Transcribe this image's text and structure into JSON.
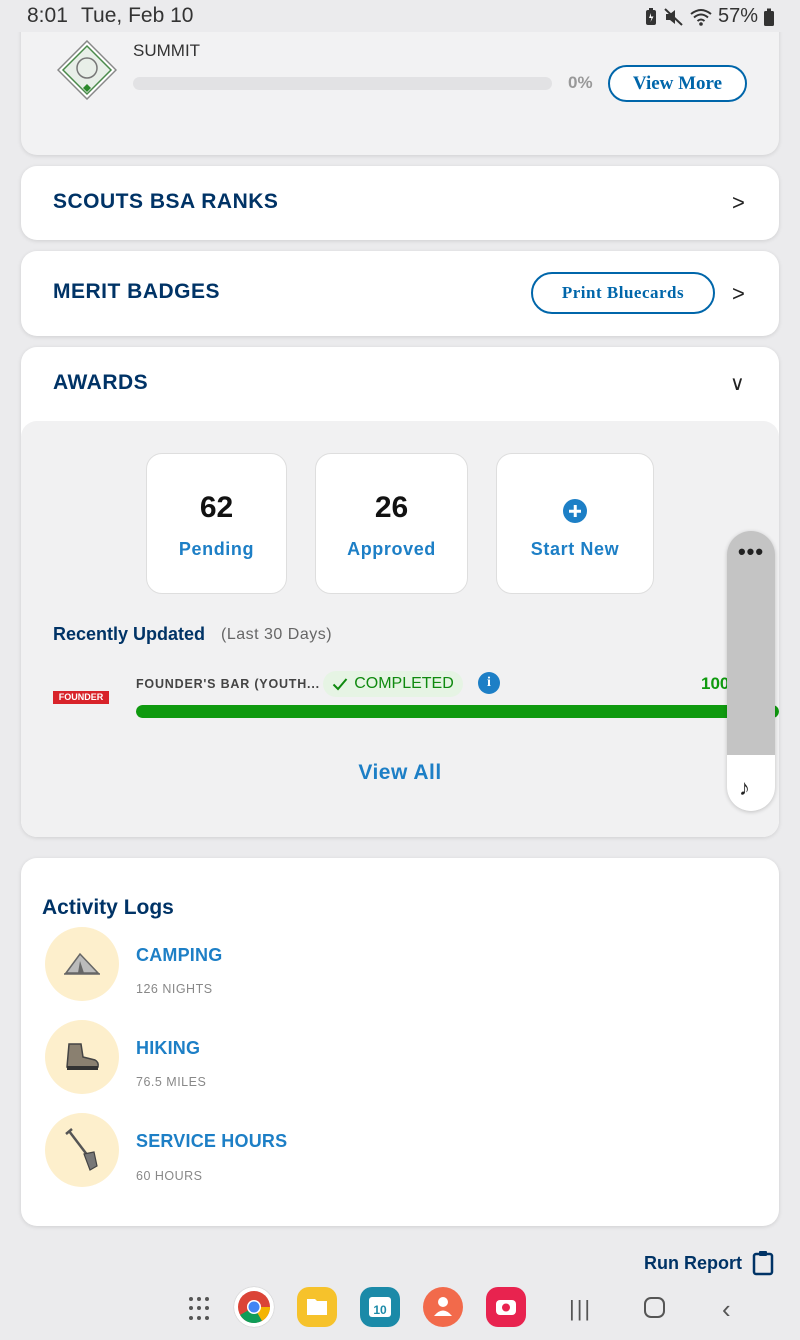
{
  "status_bar": {
    "time": "8:01",
    "date": "Tue, Feb 10",
    "battery": "57%"
  },
  "summit": {
    "name": "SUMMIT",
    "progress": 0,
    "percent_label": "0%",
    "view_more": "View More"
  },
  "ranks": {
    "title": "SCOUTS BSA RANKS",
    "chevron": ">"
  },
  "merit_badges": {
    "title": "MERIT BADGES",
    "print_label": "Print Bluecards",
    "chevron": ">"
  },
  "awards": {
    "title": "AWARDS",
    "chevron": "∨",
    "stats": [
      {
        "value": "62",
        "label": "Pending"
      },
      {
        "value": "26",
        "label": "Approved"
      }
    ],
    "start_new": "Start New",
    "recent_title": "Recently Updated",
    "recent_sub": "(Last 30 Days)",
    "recent_items": [
      {
        "logo_text": "FOUNDER",
        "name": "FOUNDER'S BAR (YOUTH...",
        "status": "COMPLETED",
        "percent_label": "100",
        "progress": 100
      }
    ],
    "view_all": "View All"
  },
  "activity_logs": {
    "title": "Activity Logs",
    "items": [
      {
        "name": "CAMPING",
        "value": "126 NIGHTS",
        "icon": "tent-icon"
      },
      {
        "name": "HIKING",
        "value": "76.5 MILES",
        "icon": "boot-icon"
      },
      {
        "name": "SERVICE HOURS",
        "value": "60 HOURS",
        "icon": "shovel-icon"
      }
    ]
  },
  "run_report": "Run Report",
  "colors": {
    "navy": "#003366",
    "link_blue": "#1d7fc6",
    "green": "#0f9a0f",
    "activity_circle": "#fdefcc"
  }
}
